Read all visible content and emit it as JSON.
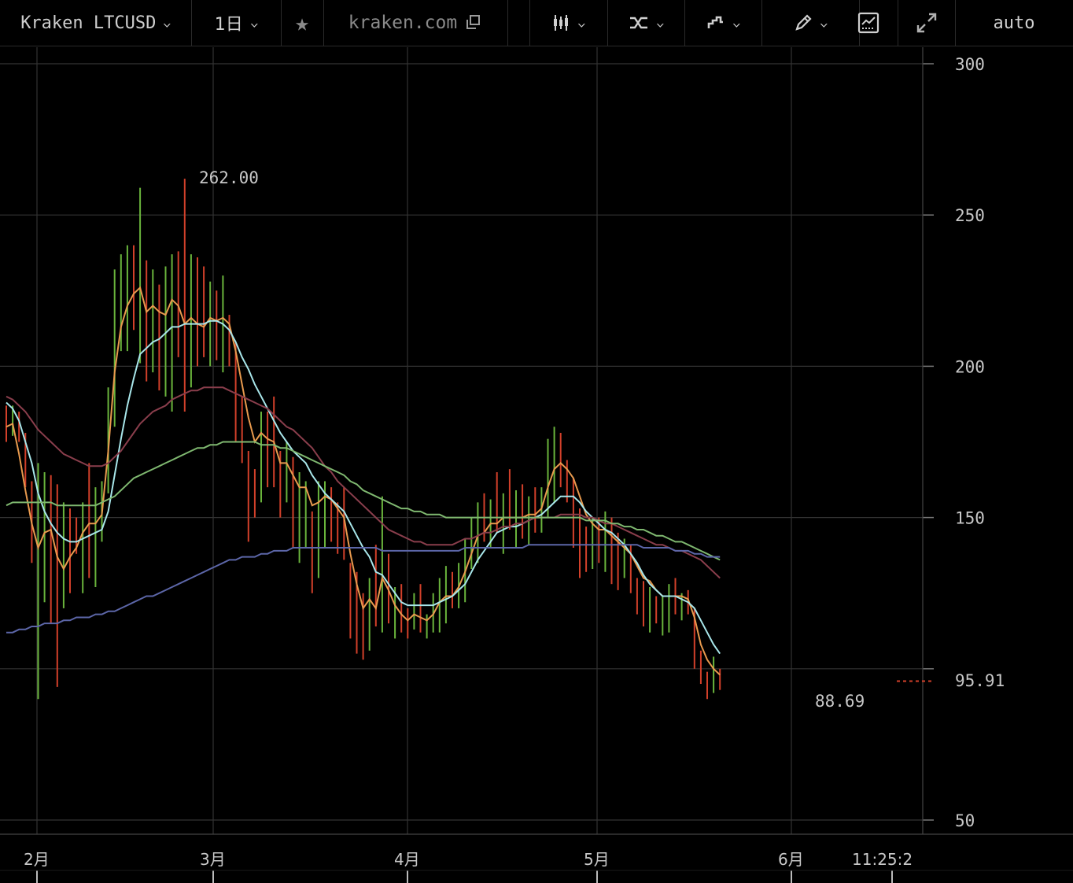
{
  "toolbar": {
    "symbol": "Kraken LTCUSD",
    "interval": "1日",
    "star_icon": "star-icon",
    "site": "kraken.com",
    "copy_icon": "copy-icon",
    "candle_icon": "candlestick-icon",
    "compare_icon": "compare-icon",
    "indicator_icon": "indicator-icon",
    "draw_icon": "pencil-icon",
    "chart_icon": "chart-icon",
    "fullscreen_icon": "expand-icon",
    "scale_mode": "auto"
  },
  "colors": {
    "background": "#000000",
    "grid": "#333333",
    "up": "#6ab43c",
    "down": "#d2402a",
    "ma_orange": "#e89a4e",
    "ma_cyan": "#a8e6ea",
    "ma_maroon": "#8a3e4c",
    "ma_green": "#7fb870",
    "ma_blue": "#5c66a8"
  },
  "chart_data": {
    "type": "candlestick",
    "title": "Kraken LTCUSD",
    "interval": "1日",
    "ylim": [
      50,
      300
    ],
    "y_ticks": [
      50,
      150,
      200,
      250,
      300
    ],
    "x_ticks": [
      "2月",
      "3月",
      "4月",
      "5月",
      "6月"
    ],
    "time_label": "11:25:2",
    "grid": true,
    "annotations": {
      "high": "262.00",
      "low": "88.69",
      "last": "95.91"
    },
    "last_price": 95.91,
    "ohlc": [
      [
        186,
        187,
        175,
        180
      ],
      [
        180,
        187,
        177,
        183
      ],
      [
        183,
        185,
        175,
        180
      ],
      [
        180,
        178,
        160,
        160
      ],
      [
        160,
        162,
        135,
        146
      ],
      [
        146,
        168,
        90,
        150
      ],
      [
        150,
        165,
        122,
        154
      ],
      [
        154,
        164,
        115,
        140
      ],
      [
        140,
        161,
        94,
        120
      ],
      [
        120,
        155,
        120,
        145
      ],
      [
        145,
        153,
        125,
        142
      ],
      [
        142,
        150,
        138,
        140
      ],
      [
        140,
        155,
        125,
        150
      ],
      [
        150,
        168,
        130,
        148
      ],
      [
        148,
        160,
        127,
        152
      ],
      [
        152,
        162,
        142,
        158
      ],
      [
        158,
        193,
        158,
        186
      ],
      [
        186,
        232,
        180,
        212
      ],
      [
        212,
        237,
        205,
        226
      ],
      [
        226,
        240,
        205,
        235
      ],
      [
        235,
        240,
        212,
        224
      ],
      [
        224,
        259,
        201,
        229
      ],
      [
        229,
        235,
        195,
        208
      ],
      [
        208,
        232,
        198,
        220
      ],
      [
        220,
        227,
        192,
        213
      ],
      [
        213,
        233,
        190,
        215
      ],
      [
        215,
        237,
        185,
        231
      ],
      [
        231,
        238,
        203,
        214
      ],
      [
        214,
        262,
        185,
        208
      ],
      [
        208,
        237,
        193,
        229
      ],
      [
        229,
        236,
        200,
        215
      ],
      [
        215,
        233,
        203,
        210
      ],
      [
        210,
        228,
        200,
        222
      ],
      [
        222,
        225,
        202,
        216
      ],
      [
        216,
        230,
        198,
        218
      ],
      [
        218,
        217,
        200,
        208
      ],
      [
        208,
        208,
        175,
        185
      ],
      [
        185,
        190,
        168,
        173
      ],
      [
        173,
        172,
        142,
        165
      ],
      [
        165,
        166,
        150,
        158
      ],
      [
        158,
        185,
        155,
        182
      ],
      [
        182,
        185,
        160,
        178
      ],
      [
        178,
        190,
        160,
        170
      ],
      [
        170,
        172,
        150,
        160
      ],
      [
        160,
        175,
        155,
        168
      ],
      [
        168,
        170,
        140,
        150
      ],
      [
        150,
        165,
        135,
        155
      ],
      [
        155,
        162,
        140,
        155
      ],
      [
        155,
        152,
        125,
        138
      ],
      [
        138,
        162,
        130,
        153
      ],
      [
        153,
        162,
        140,
        158
      ],
      [
        158,
        160,
        142,
        153
      ],
      [
        153,
        155,
        138,
        149
      ],
      [
        149,
        160,
        136,
        140
      ],
      [
        140,
        135,
        110,
        118
      ],
      [
        118,
        132,
        105,
        116
      ],
      [
        116,
        125,
        103,
        108
      ],
      [
        108,
        130,
        106,
        126
      ],
      [
        126,
        141,
        114,
        117
      ],
      [
        117,
        157,
        112,
        143
      ],
      [
        143,
        138,
        115,
        118
      ],
      [
        118,
        127,
        110,
        125
      ],
      [
        125,
        128,
        112,
        116
      ],
      [
        116,
        120,
        110,
        113
      ],
      [
        113,
        125,
        113,
        120
      ],
      [
        120,
        128,
        112,
        114
      ],
      [
        114,
        118,
        110,
        116
      ],
      [
        116,
        125,
        112,
        121
      ],
      [
        121,
        130,
        112,
        125
      ],
      [
        125,
        134,
        115,
        128
      ],
      [
        128,
        132,
        120,
        123
      ],
      [
        123,
        135,
        120,
        132
      ],
      [
        132,
        143,
        122,
        140
      ],
      [
        140,
        150,
        133,
        145
      ],
      [
        145,
        155,
        135,
        150
      ],
      [
        150,
        158,
        142,
        145
      ],
      [
        145,
        156,
        140,
        153
      ],
      [
        153,
        165,
        145,
        149
      ],
      [
        149,
        158,
        138,
        156
      ],
      [
        156,
        166,
        146,
        148
      ],
      [
        148,
        159,
        140,
        152
      ],
      [
        152,
        161,
        143,
        148
      ],
      [
        148,
        157,
        141,
        154
      ],
      [
        154,
        160,
        145,
        151
      ],
      [
        151,
        160,
        145,
        157
      ],
      [
        157,
        176,
        150,
        170
      ],
      [
        170,
        180,
        155,
        176
      ],
      [
        176,
        178,
        160,
        171
      ],
      [
        171,
        169,
        155,
        163
      ],
      [
        163,
        163,
        140,
        157
      ],
      [
        157,
        153,
        130,
        148
      ],
      [
        148,
        147,
        132,
        143
      ],
      [
        143,
        150,
        133,
        148
      ],
      [
        148,
        150,
        135,
        145
      ],
      [
        145,
        152,
        132,
        149
      ],
      [
        149,
        150,
        128,
        140
      ],
      [
        140,
        145,
        126,
        138
      ],
      [
        138,
        143,
        130,
        140
      ],
      [
        140,
        141,
        125,
        133
      ],
      [
        133,
        130,
        118,
        128
      ],
      [
        128,
        129,
        114,
        121
      ],
      [
        121,
        127,
        112,
        123
      ],
      [
        123,
        124,
        115,
        117
      ],
      [
        117,
        124,
        111,
        120
      ],
      [
        120,
        128,
        112,
        125
      ],
      [
        125,
        130,
        118,
        122
      ],
      [
        122,
        125,
        116,
        123
      ],
      [
        123,
        126,
        118,
        120
      ],
      [
        120,
        120,
        100,
        104
      ],
      [
        104,
        106,
        95,
        97
      ],
      [
        97,
        99,
        90,
        96
      ],
      [
        96,
        104,
        92,
        99
      ],
      [
        99,
        100,
        93,
        96
      ]
    ],
    "series": [
      {
        "name": "",
        "color": "#e89a4e",
        "values": [
          180,
          181,
          171,
          159,
          148,
          140,
          145,
          146,
          137,
          133,
          137,
          140,
          145,
          148,
          148,
          151,
          172,
          198,
          213,
          220,
          224,
          226,
          218,
          220,
          218,
          217,
          222,
          220,
          214,
          216,
          214,
          213,
          216,
          215,
          216,
          214,
          205,
          194,
          183,
          175,
          178,
          176,
          175,
          168,
          168,
          164,
          160,
          160,
          154,
          155,
          157,
          156,
          153,
          150,
          138,
          128,
          120,
          123,
          120,
          130,
          126,
          121,
          118,
          116,
          118,
          117,
          116,
          118,
          122,
          124,
          124,
          127,
          132,
          138,
          144,
          145,
          148,
          148,
          150,
          150,
          150,
          150,
          151,
          151,
          153,
          160,
          166,
          168,
          166,
          163,
          157,
          151,
          148,
          146,
          146,
          144,
          142,
          140,
          138,
          134,
          130,
          129,
          126,
          124,
          124,
          124,
          124,
          123,
          117,
          108,
          103,
          100,
          98
        ]
      },
      {
        "name": "",
        "color": "#a8e6ea",
        "values": [
          188,
          186,
          182,
          175,
          168,
          158,
          152,
          148,
          145,
          143,
          142,
          142,
          143,
          144,
          145,
          146,
          152,
          164,
          176,
          187,
          196,
          204,
          206,
          208,
          209,
          211,
          213,
          213,
          214,
          214,
          214,
          214,
          215,
          215,
          214,
          212,
          208,
          203,
          199,
          194,
          190,
          186,
          182,
          178,
          175,
          172,
          170,
          168,
          164,
          161,
          158,
          156,
          154,
          152,
          148,
          144,
          140,
          137,
          132,
          131,
          128,
          125,
          122,
          121,
          121,
          121,
          121,
          121,
          122,
          123,
          124,
          126,
          128,
          132,
          136,
          139,
          142,
          145,
          146,
          147,
          147,
          148,
          149,
          150,
          151,
          153,
          155,
          157,
          157,
          157,
          155,
          152,
          150,
          148,
          146,
          145,
          143,
          141,
          138,
          135,
          131,
          128,
          126,
          124,
          124,
          124,
          123,
          122,
          120,
          116,
          112,
          108,
          105
        ]
      },
      {
        "name": "",
        "color": "#8a3e4c",
        "values": [
          190,
          189,
          187,
          185,
          182,
          179,
          177,
          175,
          173,
          171,
          170,
          169,
          168,
          167,
          167,
          167,
          168,
          170,
          172,
          175,
          178,
          181,
          183,
          185,
          186,
          187,
          189,
          190,
          191,
          192,
          192,
          193,
          193,
          193,
          193,
          192,
          191,
          190,
          189,
          188,
          187,
          186,
          184,
          182,
          180,
          179,
          177,
          175,
          173,
          170,
          167,
          165,
          162,
          160,
          158,
          156,
          154,
          152,
          150,
          148,
          146,
          145,
          144,
          143,
          142,
          142,
          141,
          141,
          141,
          141,
          141,
          142,
          143,
          143,
          144,
          145,
          145,
          146,
          147,
          147,
          148,
          148,
          149,
          150,
          150,
          150,
          150,
          151,
          151,
          151,
          151,
          150,
          150,
          149,
          148,
          148,
          147,
          146,
          145,
          144,
          143,
          142,
          141,
          141,
          140,
          139,
          139,
          138,
          137,
          136,
          134,
          132,
          130
        ]
      },
      {
        "name": "",
        "color": "#7fb870",
        "values": [
          154,
          155,
          155,
          155,
          155,
          155,
          155,
          155,
          154,
          154,
          154,
          154,
          154,
          154,
          154,
          155,
          156,
          157,
          159,
          161,
          163,
          164,
          165,
          166,
          167,
          168,
          169,
          170,
          171,
          172,
          173,
          173,
          174,
          174,
          175,
          175,
          175,
          175,
          175,
          175,
          174,
          174,
          174,
          173,
          173,
          172,
          171,
          170,
          169,
          168,
          167,
          166,
          165,
          164,
          162,
          161,
          159,
          158,
          157,
          156,
          155,
          154,
          153,
          153,
          152,
          152,
          151,
          151,
          151,
          150,
          150,
          150,
          150,
          150,
          150,
          150,
          150,
          150,
          150,
          150,
          150,
          150,
          150,
          150,
          150,
          150,
          150,
          150,
          150,
          150,
          150,
          149,
          149,
          149,
          149,
          148,
          148,
          147,
          147,
          146,
          146,
          145,
          144,
          144,
          143,
          142,
          142,
          141,
          140,
          139,
          138,
          137,
          136
        ]
      },
      {
        "name": "",
        "color": "#5c66a8",
        "values": [
          112,
          112,
          113,
          113,
          114,
          114,
          115,
          115,
          115,
          116,
          116,
          117,
          117,
          117,
          118,
          118,
          119,
          119,
          120,
          121,
          122,
          123,
          124,
          124,
          125,
          126,
          127,
          128,
          129,
          130,
          131,
          132,
          133,
          134,
          135,
          136,
          136,
          137,
          137,
          137,
          138,
          138,
          139,
          139,
          139,
          140,
          140,
          140,
          140,
          140,
          140,
          140,
          140,
          140,
          140,
          140,
          140,
          140,
          140,
          139,
          139,
          139,
          139,
          139,
          139,
          139,
          139,
          139,
          139,
          139,
          139,
          139,
          140,
          140,
          140,
          140,
          140,
          140,
          140,
          140,
          140,
          140,
          141,
          141,
          141,
          141,
          141,
          141,
          141,
          141,
          141,
          141,
          141,
          141,
          141,
          141,
          141,
          141,
          141,
          141,
          140,
          140,
          140,
          140,
          140,
          139,
          139,
          139,
          138,
          138,
          137,
          137,
          137
        ]
      }
    ]
  }
}
